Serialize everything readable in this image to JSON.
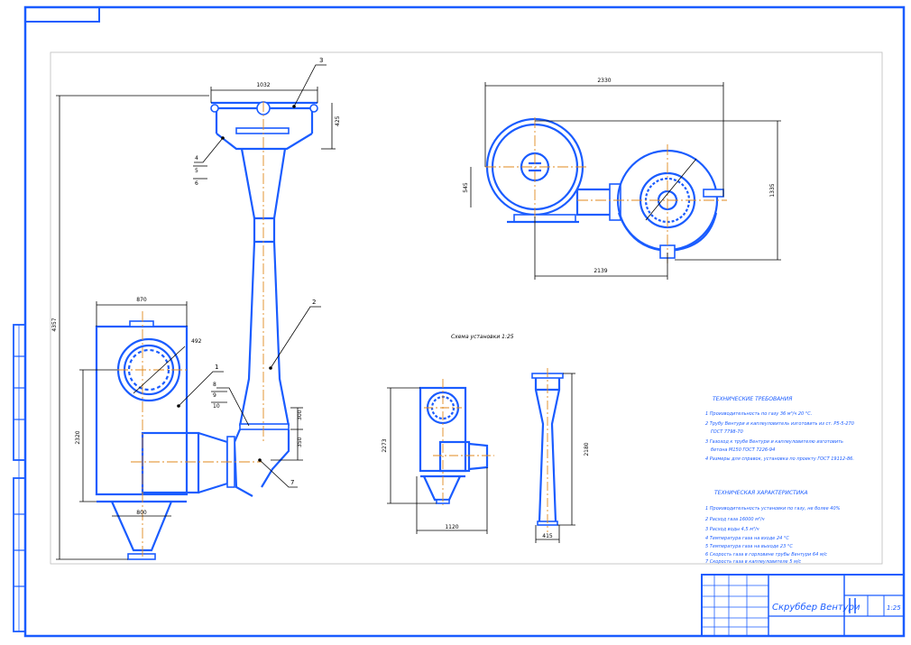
{
  "drawing": {
    "title": "Скруббер Вентури",
    "scale": "1:25",
    "sheet_id": "",
    "view_note": "Схема установки 1:25"
  },
  "dimensions": {
    "top_width": "1032",
    "top_height": "425",
    "plan_width": "2330",
    "plan_depth": "1335",
    "plan_offset": "2139",
    "plan_small": "545",
    "body_width": "870",
    "total_height": "4357",
    "body_height": "2320",
    "bottom_width": "800",
    "nozzle_diam": "492",
    "neck_h1": "300",
    "neck_h2": "350",
    "small_h": "2273",
    "small_w": "1120",
    "venturi_h": "2180",
    "venturi_w": "415"
  },
  "leaders": {
    "l1": "1",
    "l2": "2",
    "l3": "3",
    "l4": "4",
    "l5": "5",
    "l6": "6",
    "l7": "7",
    "l8": "8",
    "l9": "9",
    "l10": "10"
  },
  "technical_requirements": {
    "heading": "ТЕХНИЧЕСКИЕ ТРЕБОВАНИЯ",
    "items": [
      "1 Производительность по газу 36 м³/ч 20 °С.",
      "2 Трубу Вентури и каплеуловитель изготовить из ст. Р5-5-270",
      "ГОСТ 7798-70",
      "3 Газоход к трубе Вентури и каплеуловителю изготовить",
      "бетона М150 ГОСТ 7226-94",
      "4 Размеры для справок, установка по проекту ГОСТ 19112-86."
    ]
  },
  "technical_characteristics": {
    "heading": "ТЕХНИЧЕСКАЯ ХАРАКТЕРИСТИКА",
    "items": [
      "1 Производительность установки по газу, не более 40%",
      "2 Расход газа 16000 м³/ч",
      "3 Расход воды 4,5 м³/ч",
      "4 Температура газа на входе 24 °С",
      "5 Температура газа на выходе 23 °С",
      "6 Скорость газа в горловине трубы Вентури 64 м/с",
      "7 Скорость газа в каплеуловителе 5 м/с"
    ]
  },
  "colors": {
    "frame": "#1a5cff",
    "axis": "#e08a1e",
    "line": "#000000"
  }
}
